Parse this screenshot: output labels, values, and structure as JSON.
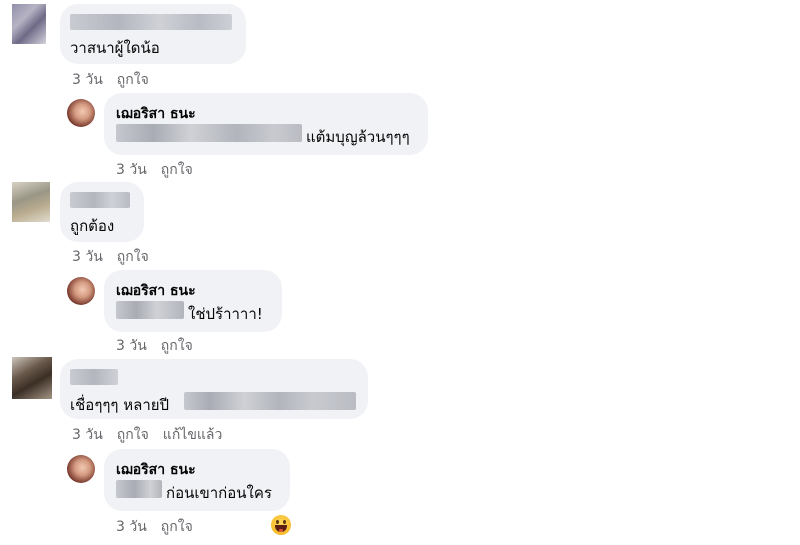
{
  "comments": [
    {
      "text": "วาสนาผู้ใดน้อ",
      "time": "3 วัน",
      "like_label": "ถูกใจ",
      "reply": {
        "author": "เฌอริสา ธนะ",
        "text": "แต้มบุญล้วนๆๆๆ",
        "time": "3 วัน",
        "like_label": "ถูกใจ"
      }
    },
    {
      "text": "ถูกต้อง",
      "time": "3 วัน",
      "like_label": "ถูกใจ",
      "reply": {
        "author": "เฌอริสา ธนะ",
        "text": "ใช่ปร้าาาา!",
        "time": "3 วัน",
        "like_label": "ถูกใจ"
      }
    },
    {
      "text": "เชื่อๆๆๆ หลายปี",
      "time": "3 วัน",
      "like_label": "ถูกใจ",
      "edited_label": "แก้ไขแล้ว",
      "reply": {
        "author": "เฌอริสา ธนะ",
        "text": "ก่อนเขาก่อนใคร",
        "time": "3 วัน",
        "like_label": "ถูกใจ",
        "reaction_icon": "laughing-emoji"
      }
    }
  ]
}
